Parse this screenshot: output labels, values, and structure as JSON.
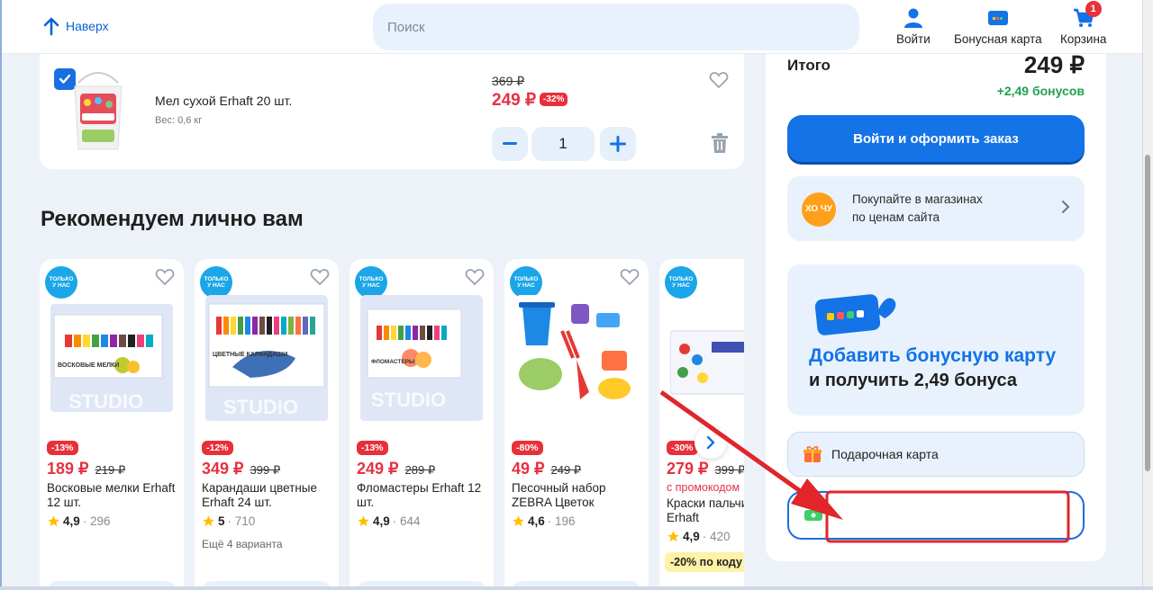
{
  "header": {
    "back_top_label": "Наверх",
    "search_placeholder": "Поиск",
    "login_label": "Войти",
    "bonus_card_label": "Бонусная карта",
    "cart_label": "Корзина",
    "cart_count": "1"
  },
  "cart_item": {
    "title": "Мел сухой Erhaft 20 шт.",
    "weight": "Вес: 0,6 кг",
    "old_price": "369 ₽",
    "new_price": "249 ₽",
    "discount": "-32%",
    "quantity": "1",
    "minus_symbol": "−",
    "plus_symbol": "+"
  },
  "recommendations": {
    "title": "Рекомендуем лично вам",
    "only_badge_line1": "ТОЛЬКО",
    "only_badge_line2": "У НАС",
    "cards": [
      {
        "discount": "-13%",
        "price": "189 ₽",
        "old_price": "219 ₽",
        "name": "Восковые мелки Erhaft 12 шт.",
        "rating": "4,9",
        "reviews": "· 296",
        "variants": "",
        "image_label": "ВОСКОВЫЕ МЕЛКИ"
      },
      {
        "discount": "-12%",
        "price": "349 ₽",
        "old_price": "399 ₽",
        "name": "Карандаши цветные Erhaft 24 шт.",
        "rating": "5",
        "reviews": "· 710",
        "variants": "Ещё 4 варианта",
        "image_label": "ЦВЕТНЫЕ КАРАНДАШИ"
      },
      {
        "discount": "-13%",
        "price": "249 ₽",
        "old_price": "289 ₽",
        "name": "Фломастеры Erhaft 12 шт.",
        "rating": "4,9",
        "reviews": "· 644",
        "variants": "",
        "image_label": "ФЛОМАСТЕРЫ"
      },
      {
        "discount": "-80%",
        "price": "49 ₽",
        "old_price": "249 ₽",
        "name": "Песочный набор ZEBRA Цветок",
        "rating": "4,6",
        "reviews": "· 196",
        "variants": ""
      },
      {
        "discount": "-30%",
        "price": "279 ₽",
        "old_price": "399 ₽",
        "promo_note": "с промокодом",
        "name": "Краски пальчиковые Erhaft",
        "rating": "4,9",
        "reviews": "· 420",
        "promo_chip": "-20% по коду"
      }
    ]
  },
  "summary": {
    "total_label": "Итого",
    "total_value": "249 ₽",
    "bonus": "+2,49 бонусов",
    "checkout_button": "Войти и оформить заказ",
    "store_promo_line1": "Покупайте в магазинах",
    "store_promo_line2": "по ценам сайта",
    "store_logo": "ХО ЧУ",
    "bonus_card_title": "Добавить бонусную карту",
    "bonus_card_sub": "и получить 2,49 бонуса",
    "gift_card_label": "Подарочная карта"
  },
  "colors": {
    "accent": "#1473e6",
    "price_red": "#e63245",
    "bonus_green": "#22a050",
    "annotation_red": "#e0262b"
  }
}
